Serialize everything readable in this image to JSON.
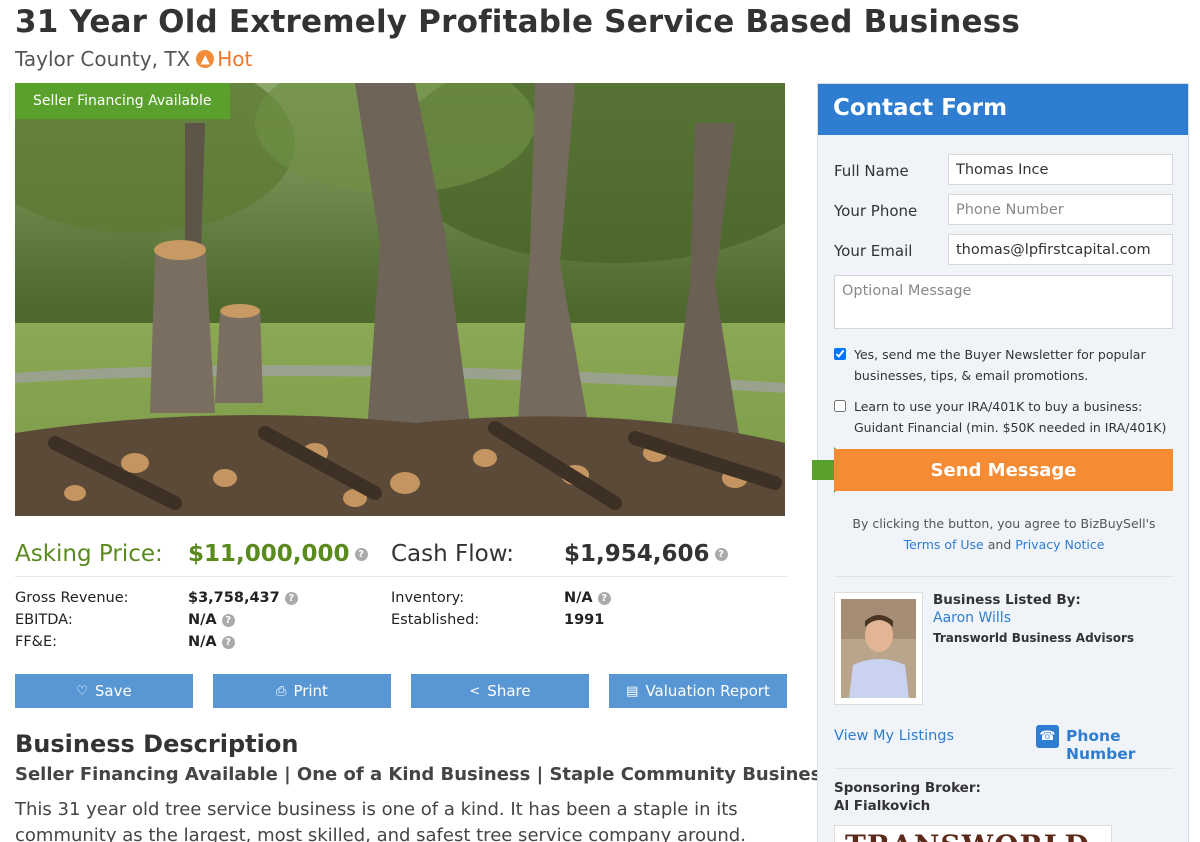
{
  "listing": {
    "title": "31 Year Old Extremely Profitable Service Based Business",
    "location": "Taylor County, TX",
    "hot_label": "Hot",
    "badge": "Seller Financing Available"
  },
  "financials": {
    "asking_label": "Asking Price:",
    "asking_value": "$11,000,000",
    "cashflow_label": "Cash Flow:",
    "cashflow_value": "$1,954,606",
    "rows_left": [
      {
        "label": "Gross Revenue:",
        "value": "$3,758,437"
      },
      {
        "label": "EBITDA:",
        "value": "N/A"
      },
      {
        "label": "FF&E:",
        "value": "N/A"
      }
    ],
    "rows_right": [
      {
        "label": "Inventory:",
        "value": "N/A"
      },
      {
        "label": "Established:",
        "value": "1991"
      }
    ]
  },
  "actions": {
    "save": "Save",
    "print": "Print",
    "share": "Share",
    "valuation": "Valuation Report"
  },
  "description": {
    "heading": "Business Description",
    "subheading": "Seller Financing Available | One of a Kind Business | Staple Community Business",
    "body": "This 31 year old tree service business is one of a kind. It has been a staple in its community as the largest, most skilled, and safest tree service company around. Accompanied by two sister"
  },
  "contact": {
    "heading": "Contact Form",
    "full_name_label": "Full Name",
    "full_name_value": "Thomas Ince",
    "phone_label": "Your Phone",
    "phone_placeholder": "Phone Number",
    "email_label": "Your Email",
    "email_value": "thomas@lpfirstcapital.com",
    "message_placeholder": "Optional Message",
    "newsletter_text": "Yes, send me the Buyer Newsletter for popular businesses, tips, & email promotions.",
    "newsletter_checked": true,
    "ira_text": "Learn to use your IRA/401K to buy a business: Guidant Financial (min. $50K needed in IRA/401K)",
    "ira_checked": false,
    "send_label": "Send Message",
    "legal_prefix": "By clicking the button, you agree to BizBuySell's",
    "terms_label": "Terms of Use",
    "legal_and": "and",
    "privacy_label": "Privacy Notice"
  },
  "broker": {
    "listed_by_label": "Business Listed By:",
    "name": "Aaron Wills",
    "company": "Transworld Business Advisors",
    "view_listings": "View My Listings",
    "phone_label": "Phone Number",
    "sponsor_label": "Sponsoring Broker:",
    "sponsor_name": "Al Fialkovich",
    "logo_text": "TRANSWORLD"
  },
  "colors": {
    "accent_blue": "#2f7dd1",
    "button_blue": "#5897d3",
    "price_green": "#5a8a1e",
    "badge_green": "#5aa02c",
    "send_orange": "#f58b32",
    "hot_orange": "#f0752b"
  },
  "icons": {
    "hot": "flame-icon",
    "help": "question-circle-icon",
    "save": "heart-icon",
    "print": "printer-icon",
    "share": "share-icon",
    "valuation": "report-icon",
    "phone": "phone-icon",
    "arrow": "green-arrow-icon"
  }
}
